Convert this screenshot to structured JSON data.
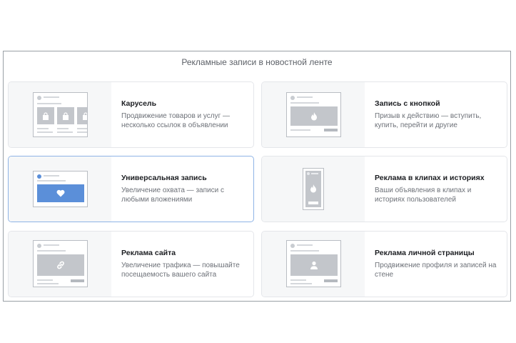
{
  "section": {
    "title": "Рекламные записи в новостной ленте"
  },
  "cards": [
    {
      "title": "Карусель",
      "description": "Продвижение товаров и услуг — несколько ссылок в объявлении",
      "icon": "shopping-bag-icon"
    },
    {
      "title": "Запись с кнопкой",
      "description": "Призыв к действию — вступить, купить, перейти и другие",
      "icon": "flame-icon"
    },
    {
      "title": "Универсальная запись",
      "description": "Увеличение охвата — записи с любыми вложениями",
      "icon": "heart-icon",
      "selected": true
    },
    {
      "title": "Реклама в клипах и историях",
      "description": "Ваши объявления в клипах и историях пользователей",
      "icon": "flame-icon"
    },
    {
      "title": "Реклама сайта",
      "description": "Увеличение трафика — повышайте посещаемость вашего сайта",
      "icon": "link-icon"
    },
    {
      "title": "Реклама личной страницы",
      "description": "Продвижение профиля и записей на стене",
      "icon": "user-icon"
    }
  ],
  "colors": {
    "accent": "#5b8fd9",
    "selected_border": "#8fb4e6",
    "placeholder": "#c3c6cb"
  }
}
